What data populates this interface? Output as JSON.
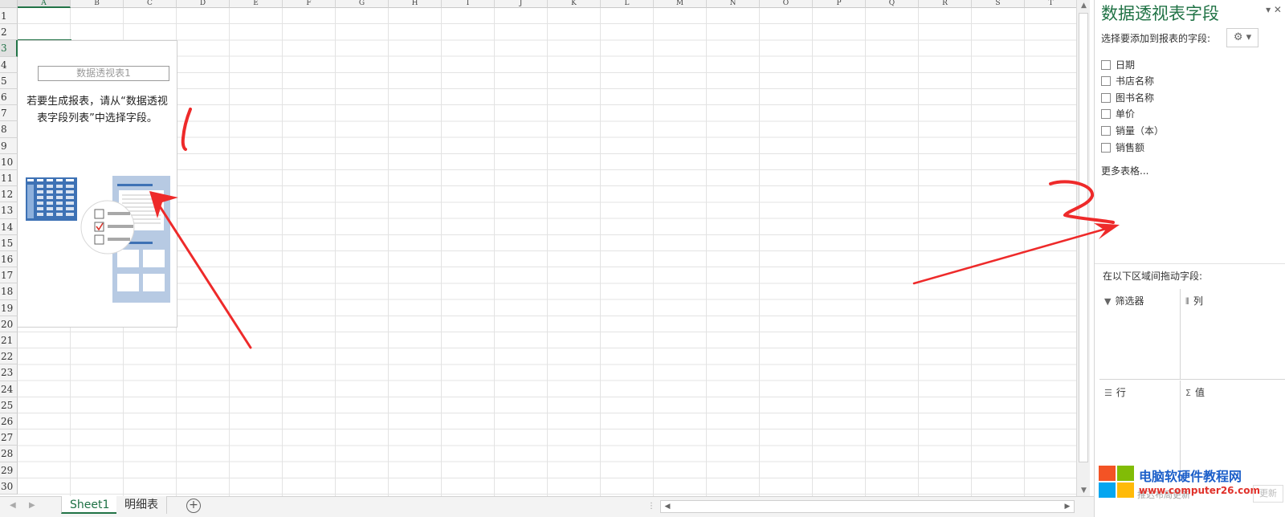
{
  "sheet": {
    "columns": [
      "A",
      "B",
      "C",
      "D",
      "E",
      "F",
      "G",
      "H",
      "I",
      "J",
      "K",
      "L",
      "M",
      "N",
      "O",
      "P",
      "Q",
      "R",
      "S",
      "T"
    ],
    "rows": [
      "1",
      "2",
      "3",
      "4",
      "5",
      "6",
      "7",
      "8",
      "9",
      "10",
      "11",
      "12",
      "13",
      "14",
      "15",
      "16",
      "17",
      "18",
      "19",
      "20",
      "21",
      "22",
      "23",
      "24",
      "25",
      "26",
      "27",
      "28",
      "29",
      "30"
    ],
    "selected_column": "A",
    "selected_row": "3"
  },
  "pivot": {
    "name": "数据透视表1",
    "message": "若要生成报表，请从“数据透视表字段列表”中选择字段。"
  },
  "tabs": {
    "sheet1": "Sheet1",
    "detail": "明细表",
    "add": "+"
  },
  "field_pane": {
    "title": "数据透视表字段",
    "subtitle": "选择要添加到报表的字段:",
    "gear_label": "⚙ ▾",
    "controls": "▾ ✕",
    "fields": [
      {
        "label": "日期",
        "checked": false
      },
      {
        "label": "书店名称",
        "checked": false
      },
      {
        "label": "图书名称",
        "checked": false
      },
      {
        "label": "单价",
        "checked": false
      },
      {
        "label": "销量（本）",
        "checked": false
      },
      {
        "label": "销售额",
        "checked": false
      }
    ],
    "more_tables": "更多表格...",
    "drag_label": "在以下区域间拖动字段:",
    "zones": {
      "filter": "筛选器",
      "columns": "列",
      "rows": "行",
      "values": "值"
    },
    "defer_update": "推迟布局更新",
    "update_button": "更新"
  },
  "watermark": {
    "name": "电脑软硬件教程网",
    "url": "www.computer26.com"
  },
  "colors": {
    "excel_green": "#217346",
    "annotation_red": "#ee2a2a"
  }
}
